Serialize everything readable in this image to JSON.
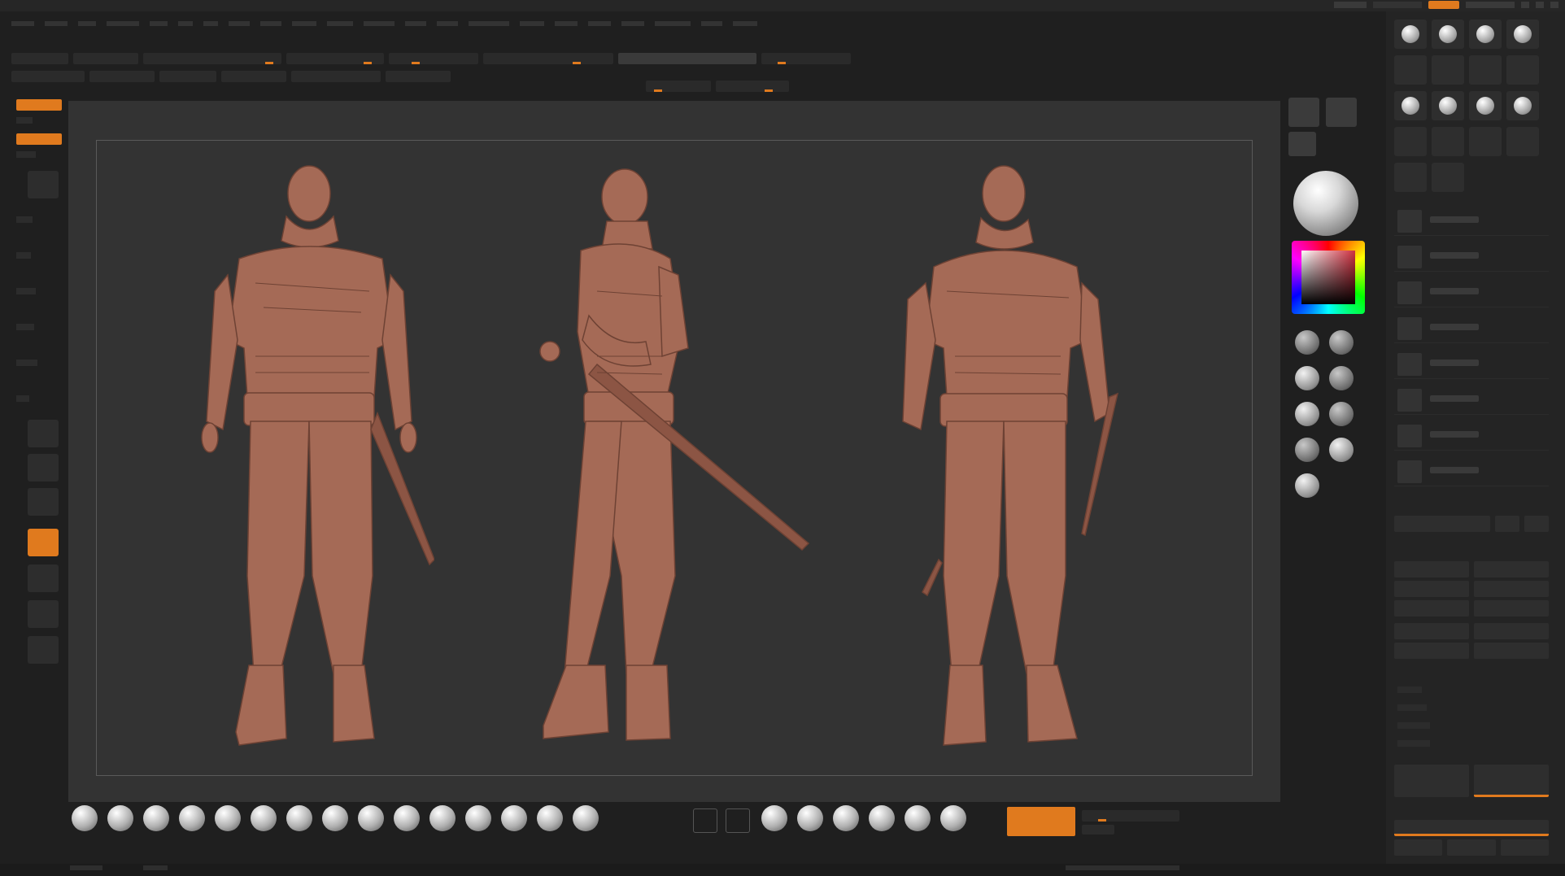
{
  "colors": {
    "accent": "#e07a1e",
    "canvas_bg": "#333333",
    "ui_bg": "#1f1f1f",
    "clay": "#a56a56"
  },
  "title_bar": {
    "right_buttons": [
      "",
      "",
      "",
      ""
    ]
  },
  "menu": [],
  "toolbar": {
    "row1": [],
    "row2": []
  },
  "left_shelf": {
    "items": []
  },
  "canvas": {
    "figures": [
      "front-view",
      "side-view",
      "three-quarter-view"
    ]
  },
  "right_panel": {
    "buttons": []
  },
  "bottom_shelf": {
    "brushes": []
  }
}
